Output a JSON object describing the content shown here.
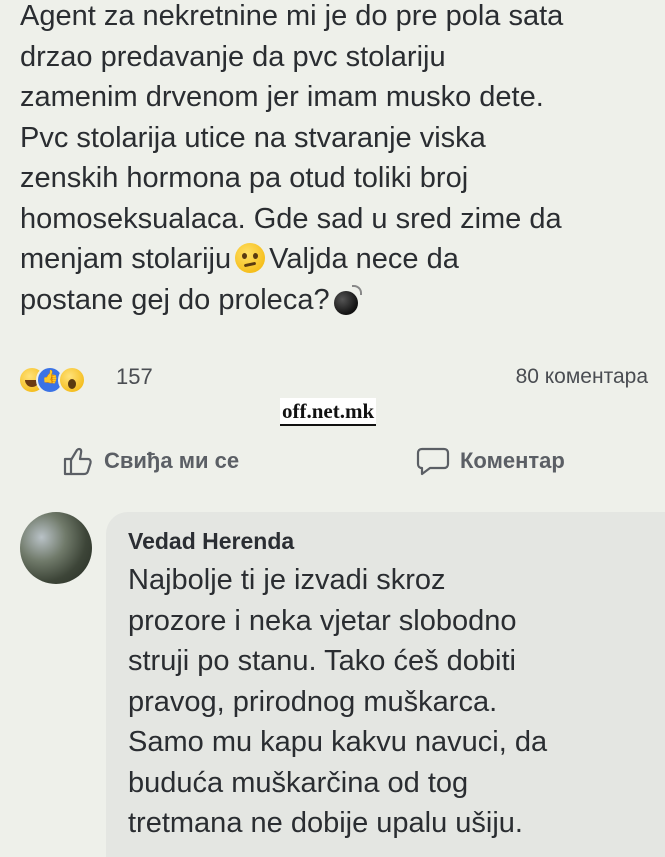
{
  "post": {
    "lines": [
      "Agent za nekretnine mi je do pre pola sata",
      "drzao predavanje da pvc stolariju",
      "zamenim drvenom jer imam musko dete.",
      "Pvc stolarija utice na stvaranje viska",
      "zenskih hormona pa otud toliki broj",
      "homoseksualaca. Gde sad u sred zime da",
      "menjam stolariju",
      "Valjda nece da",
      "postane gej do proleca?"
    ],
    "emoji_after_stolariju": "confused-face-icon",
    "emoji_end": "bomb-icon"
  },
  "stats": {
    "reactions": [
      "haha",
      "like",
      "wow"
    ],
    "reaction_count": "157",
    "comment_count": "80 коментара"
  },
  "watermark": "off.net.mk",
  "actions": {
    "like_label": "Свиђа ми се",
    "comment_label": "Коментар"
  },
  "comment": {
    "author": "Vedad Herenda",
    "lines": [
      "Najbolje ti je izvadi skroz",
      "prozore i neka vjetar slobodno",
      "struji po stanu. Tako ćeš dobiti",
      "pravog, prirodnog muškarca.",
      "Samo mu kapu kakvu navuci, da",
      "buduća muškarčina od tog",
      "tretmana ne dobije upalu ušiju."
    ]
  },
  "colors": {
    "background": "#eef0ea",
    "bubble": "#e4e6e2",
    "text": "#2a2d31",
    "muted": "#5b5f65",
    "like_blue": "#3b73e6"
  }
}
